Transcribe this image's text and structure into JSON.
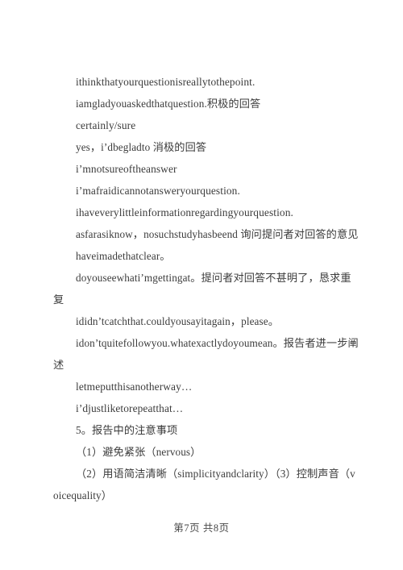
{
  "document": {
    "paragraphs": [
      "ithinkthatyourquestionisreallytothepoint.",
      "iamgladyouaskedthatquestion.积极的回答",
      "certainly/sure",
      "yes，i’dbegladto 消极的回答",
      "i’mnotsureoftheanswer",
      "i’mafraidicannotansweryourquestion.",
      "ihaveverylittleinformationregardingyourquestion.",
      "asfarasiknow，nosuchstudyhasbeend 询问提问者对回答的意见",
      "haveimadethatclear。",
      "doyouseewhati’mgettingat。提问者对回答不甚明了，恳求重复",
      "ididn’tcatchthat.couldyousayitagain，please。",
      "idon’tquitefollowyou.whatexactlydoyoumean。报告者进一步阐述",
      "letmeputthisanotherway…",
      "i’djustliketorepeatthat…",
      "5。报告中的注意事项",
      "（1）避免紧张（nervous）",
      "（2）用语简洁清晰（simplicityandclarity）（3）控制声音（voicequality）"
    ]
  },
  "footer": {
    "page_label": "第7页 共8页"
  },
  "colors": {
    "text": "#3c3c3c",
    "background": "#ffffff",
    "footer_text": "#4a4a4a"
  }
}
